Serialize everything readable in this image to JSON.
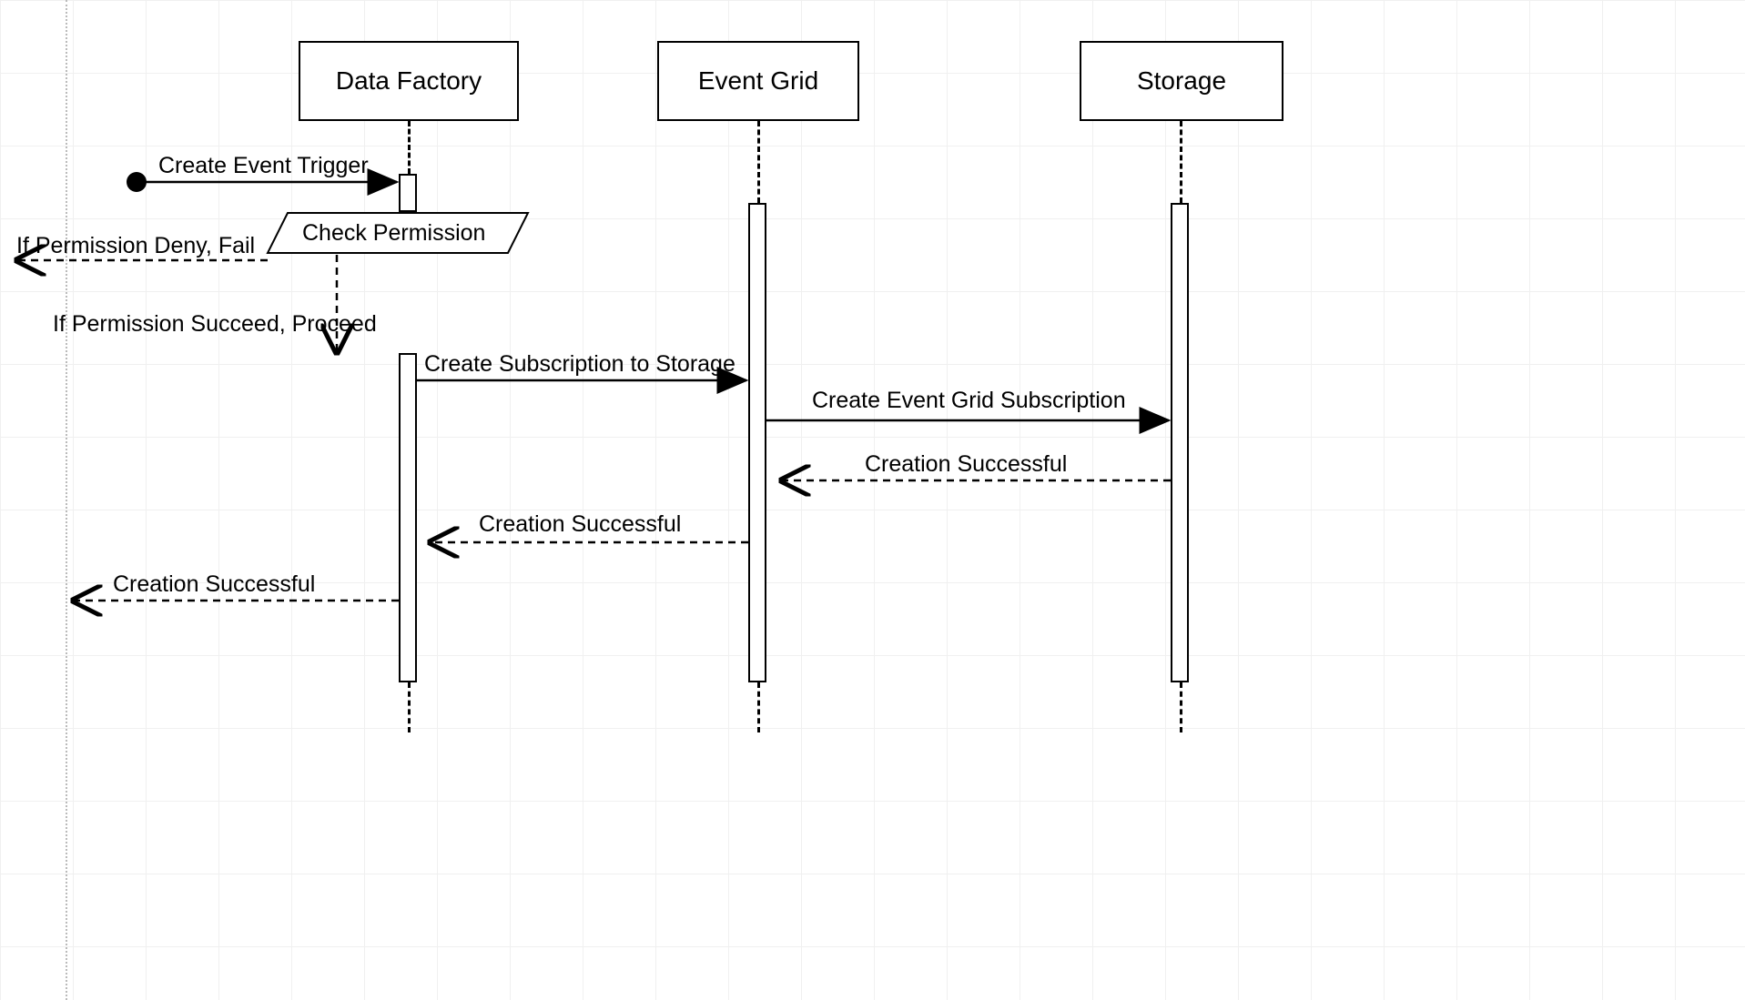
{
  "diagram": {
    "type": "sequence",
    "participants": {
      "data_factory": "Data Factory",
      "event_grid": "Event Grid",
      "storage": "Storage"
    },
    "decision": "Check Permission",
    "messages": {
      "create_trigger": "Create Event Trigger",
      "deny_fail": "If Permission Deny, Fail",
      "succeed_proceed": "If Permission Succeed, Proceed",
      "create_sub_storage": "Create Subscription to Storage",
      "create_eg_sub": "Create Event Grid Subscription",
      "creation_success_1": "Creation Successful",
      "creation_success_2": "Creation Successful",
      "creation_success_3": "Creation Successful"
    }
  }
}
